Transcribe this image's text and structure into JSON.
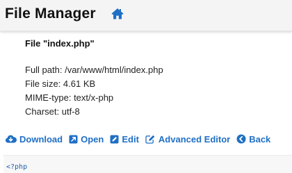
{
  "header": {
    "title": "File Manager",
    "home_icon": "home-icon"
  },
  "file": {
    "title": "File \"index.php\"",
    "full_path": "Full path: /var/www/html/index.php",
    "size": "File size: 4.61 KB",
    "mime": "MIME-type: text/x-php",
    "charset": "Charset: utf-8"
  },
  "actions": {
    "download": "Download",
    "open": "Open",
    "edit": "Edit",
    "advanced_editor": "Advanced Editor",
    "back": "Back"
  },
  "code": {
    "first_line": "<?php"
  },
  "colors": {
    "accent": "#1f6fc5",
    "header_bg": "#f4f4f4"
  }
}
